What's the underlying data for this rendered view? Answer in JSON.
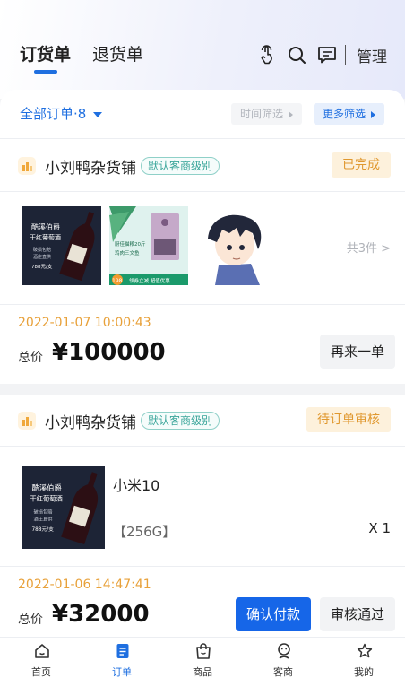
{
  "header": {
    "tabs": [
      {
        "label": "订货单",
        "active": true
      },
      {
        "label": "退货单",
        "active": false
      }
    ],
    "icons": [
      "tap-icon",
      "search-icon",
      "message-icon"
    ],
    "manage_label": "管理"
  },
  "filters": {
    "all_orders_label": "全部订单·8",
    "time_filter_label": "时间筛选",
    "more_filter_label": "更多筛选"
  },
  "orders": [
    {
      "store_name": "小刘鸭杂货铺",
      "level": "默认客商级别",
      "status": "已完成",
      "product_images": [
        {
          "title": "酷溪伯爵",
          "subtitle": "干红葡萄酒",
          "lines": [
            "破损包赔",
            "酒庄直供"
          ],
          "price": "788元/支"
        },
        {
          "lines": [
            "厨佳猫粮20斤",
            "鸡肉三文鱼"
          ],
          "price": "198",
          "promo": "领券立减 超值优惠"
        },
        {
          "kind": "cartoon-boy"
        }
      ],
      "item_count_label": "共3件 >",
      "time": "2022-01-07 10:00:43",
      "total_label": "总价",
      "total_amount": "¥100000",
      "buttons": [
        "再来一单"
      ]
    },
    {
      "store_name": "小刘鸭杂货铺",
      "level": "默认客商级别",
      "status": "待订单审核",
      "product_image": {
        "title": "酷溪伯爵",
        "subtitle": "干红葡萄酒",
        "lines": [
          "破损包赔",
          "酒庄直供"
        ],
        "price": "788元/支"
      },
      "product_name": "小米10",
      "product_spec": "【256G】",
      "quantity": "X 1",
      "time": "2022-01-06 14:47:41",
      "total_label": "总价",
      "total_amount": "¥32000",
      "buttons": [
        "确认付款",
        "审核通过"
      ]
    }
  ],
  "bottom_nav": [
    {
      "label": "首页",
      "icon": "home-icon",
      "active": false
    },
    {
      "label": "订单",
      "icon": "order-icon",
      "active": true
    },
    {
      "label": "商品",
      "icon": "bag-icon",
      "active": false
    },
    {
      "label": "客商",
      "icon": "customer-icon",
      "active": false
    },
    {
      "label": "我的",
      "icon": "star-icon",
      "active": false
    }
  ],
  "colors": {
    "accent": "#1f6fe0",
    "primary_button": "#1666e8",
    "status_text": "#e0982f",
    "status_bg": "#fdf1dc",
    "time_text": "#e8a13a",
    "level_badge": "#3aa59a"
  }
}
